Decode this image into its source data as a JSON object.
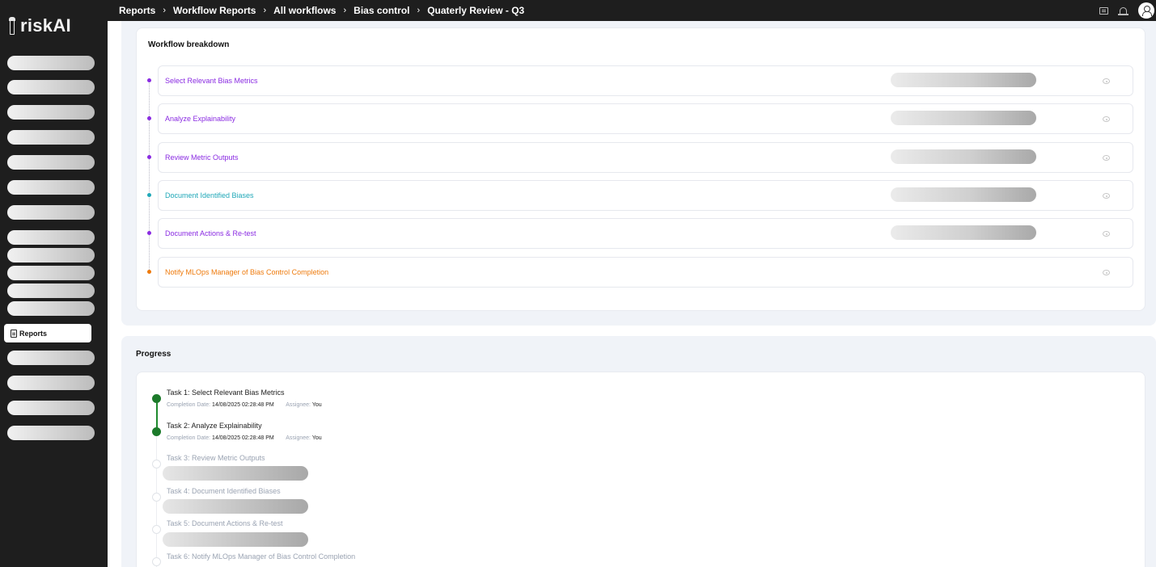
{
  "app": {
    "brand": "riskAI"
  },
  "breadcrumb": [
    "Reports",
    "Workflow Reports",
    "All workflows",
    "Bias control",
    "Quaterly Review - Q3"
  ],
  "sidebar": {
    "active_label": "Reports"
  },
  "workflow": {
    "title": "Workflow breakdown",
    "steps": [
      {
        "label": "Select Relevant Bias Metrics",
        "color": "#8a2be2"
      },
      {
        "label": "Analyze Explainability",
        "color": "#8a2be2"
      },
      {
        "label": "Review Metric Outputs",
        "color": "#8a2be2"
      },
      {
        "label": "Document Identified Biases",
        "color": "#20a8b8"
      },
      {
        "label": "Document Actions & Re-test",
        "color": "#8a2be2"
      },
      {
        "label": "Notify MLOps Manager of Bias Control Completion",
        "color": "#ee7a0c"
      }
    ]
  },
  "progress": {
    "title": "Progress",
    "labels": {
      "completion_date": "Completion Date:",
      "assignee": "Assignee:"
    },
    "tasks": [
      {
        "title": "Task 1: Select Relevant Bias Metrics",
        "status": "done",
        "completion_date": "14/08/2025 02:28:48 PM",
        "assignee": "You"
      },
      {
        "title": "Task 2: Analyze Explainability",
        "status": "done",
        "completion_date": "14/08/2025 02:28:48 PM",
        "assignee": "You"
      },
      {
        "title": "Task 3: Review Metric Outputs",
        "status": "todo"
      },
      {
        "title": "Task 4: Document Identified Biases",
        "status": "todo"
      },
      {
        "title": "Task 5: Document Actions & Re-test",
        "status": "todo"
      },
      {
        "title": "Task 6: Notify MLOps Manager of Bias Control Completion",
        "status": "todo"
      }
    ]
  }
}
